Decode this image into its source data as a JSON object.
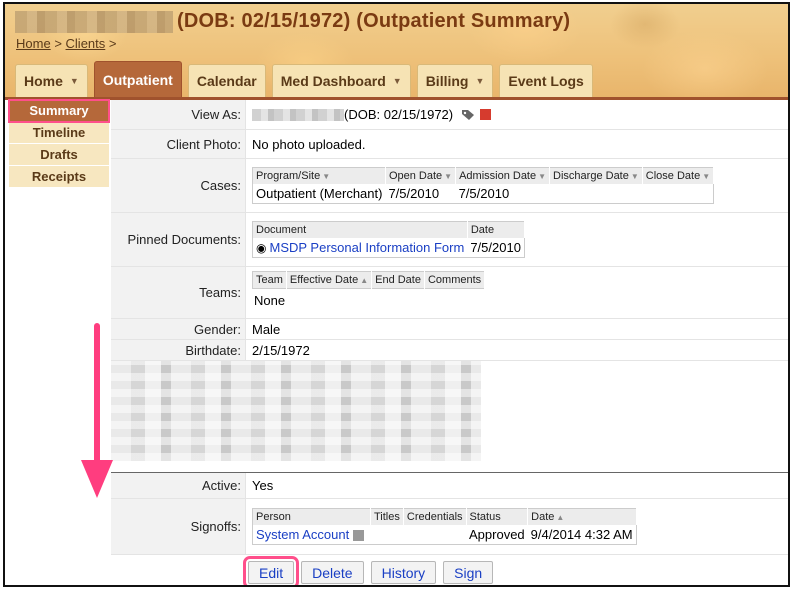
{
  "header": {
    "title": "(DOB: 02/15/1972) (Outpatient Summary)",
    "breadcrumb": {
      "home": "Home",
      "sep1": ">",
      "clients": "Clients",
      "sep2": ">"
    }
  },
  "tabs": [
    {
      "label": "Home",
      "has_menu": true
    },
    {
      "label": "Outpatient",
      "has_menu": false,
      "active": true
    },
    {
      "label": "Calendar",
      "has_menu": false
    },
    {
      "label": "Med Dashboard",
      "has_menu": true
    },
    {
      "label": "Billing",
      "has_menu": true
    },
    {
      "label": "Event Logs",
      "has_menu": false
    }
  ],
  "leftnav": [
    "Summary",
    "Timeline",
    "Drafts",
    "Receipts"
  ],
  "fields": {
    "view_as": {
      "label": "View As:",
      "value": "(DOB: 02/15/1972)"
    },
    "client_photo": {
      "label": "Client Photo:",
      "value": "No photo uploaded."
    },
    "cases": {
      "label": "Cases:",
      "headers": [
        "Program/Site",
        "Open Date",
        "Admission Date",
        "Discharge Date",
        "Close Date"
      ],
      "rows": [
        [
          "Outpatient (Merchant)",
          "7/5/2010",
          "7/5/2010",
          "",
          ""
        ]
      ]
    },
    "pinned": {
      "label": "Pinned Documents:",
      "headers": [
        "Document",
        "Date"
      ],
      "rows": [
        [
          "MSDP Personal Information Form",
          "7/5/2010"
        ]
      ]
    },
    "teams": {
      "label": "Teams:",
      "headers": [
        "Team",
        "Effective Date",
        "End Date",
        "Comments"
      ],
      "empty": "None"
    },
    "gender": {
      "label": "Gender:",
      "value": "Male"
    },
    "birthdate": {
      "label": "Birthdate:",
      "value": "2/15/1972"
    },
    "active": {
      "label": "Active:",
      "value": "Yes"
    },
    "signoffs": {
      "label": "Signoffs:",
      "headers": [
        "Person",
        "Titles",
        "Credentials",
        "Status",
        "Date"
      ],
      "rows": [
        [
          "System Account",
          "",
          "",
          "Approved",
          "9/4/2014 4:32 AM"
        ]
      ]
    }
  },
  "buttons": [
    "Edit",
    "Delete",
    "History",
    "Sign"
  ],
  "colors": {
    "accent": "#b5683a",
    "highlight": "#ff4f8b",
    "link": "#1a3fc4"
  }
}
